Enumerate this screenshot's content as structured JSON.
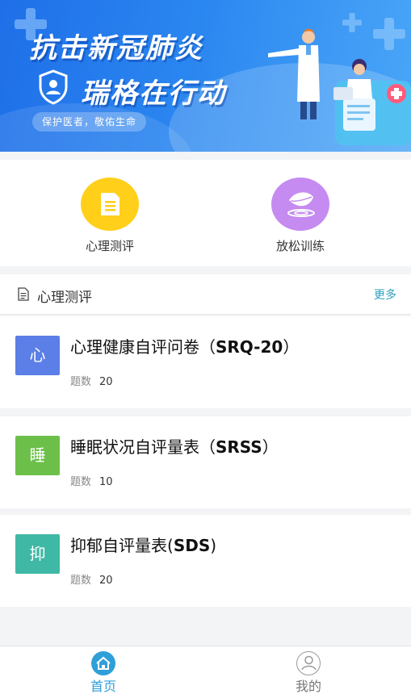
{
  "banner": {
    "title": "抗击新冠肺炎",
    "subtitle": "瑞格在行动",
    "slogan": "保护医者，敬佑生命"
  },
  "quick_entries": [
    {
      "label": "心理测评",
      "icon": "document-icon",
      "color": "#ffcf1a"
    },
    {
      "label": "放松训练",
      "icon": "leaf-icon",
      "color": "#c58bf0"
    }
  ],
  "section": {
    "title": "心理测评",
    "more": "更多"
  },
  "assessments": [
    {
      "badge": "心",
      "title_cn": "心理健康自评问卷（",
      "title_en": "SRQ-20",
      "title_end": "）",
      "meta_label": "题数",
      "count": "20",
      "color": "#5b7fe6"
    },
    {
      "badge": "睡",
      "title_cn": "睡眠状况自评量表（",
      "title_en": "SRSS",
      "title_end": "）",
      "meta_label": "题数",
      "count": "10",
      "color": "#6cc04a"
    },
    {
      "badge": "抑",
      "title_cn": "抑郁自评量表(",
      "title_en": "SDS",
      "title_end": ")",
      "meta_label": "题数",
      "count": "20",
      "color": "#3fb8a5"
    }
  ],
  "tabbar": {
    "home": "首页",
    "mine": "我的",
    "active_color": "#2f9fd8"
  }
}
